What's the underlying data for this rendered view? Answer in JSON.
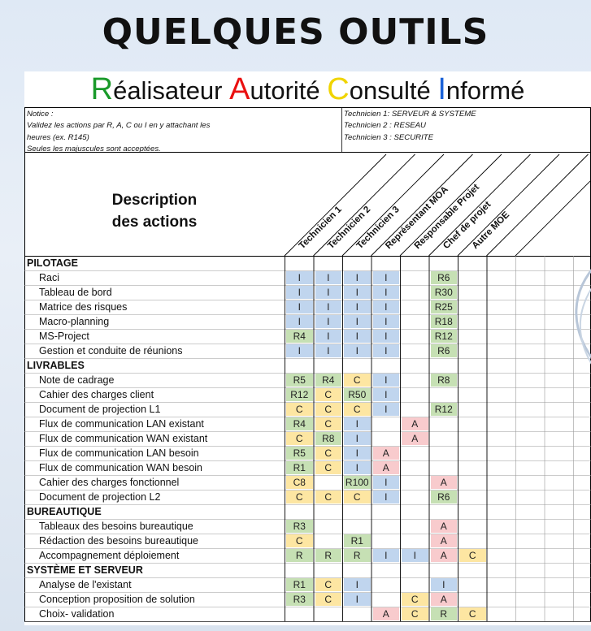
{
  "title": "QUELQUES OUTILS",
  "raci_title": [
    {
      "initial": "R",
      "rest": "éalisateur",
      "color": "r"
    },
    {
      "initial": "A",
      "rest": "utorité",
      "color": "a"
    },
    {
      "initial": "C",
      "rest": "onsulté",
      "color": "c"
    },
    {
      "initial": "I",
      "rest": "nformé",
      "color": "i"
    }
  ],
  "notice": [
    "Notice :",
    "Validez les actions par R, A, C ou I en y attachant les",
    "heures (ex. R145)",
    "Seules les majuscules sont acceptées."
  ],
  "technicians": [
    "Technicien 1:  SERVEUR & SYSTEME",
    "Technicien 2 :  RESEAU",
    "Technicien 3 : SECURITE"
  ],
  "description_header": [
    "Description",
    "des actions"
  ],
  "columns": [
    "Technicien 1",
    "Technicien 2",
    "Technicien 3",
    "Représentant MOA",
    "Responsable Projet",
    "Chef de projet",
    "Autre MOE"
  ],
  "colors": {
    "R": "#c6e0b4",
    "A": "#f8cbcd",
    "C": "#fde6a2",
    "I": "#c0d5ee"
  },
  "rows": [
    {
      "type": "section",
      "label": "PILOTAGE"
    },
    {
      "type": "item",
      "label": "Raci",
      "cells": [
        "I",
        "I",
        "I",
        "I",
        "",
        "R6",
        "",
        ""
      ]
    },
    {
      "type": "item",
      "label": "Tableau de bord",
      "cells": [
        "I",
        "I",
        "I",
        "I",
        "",
        "R30",
        "",
        ""
      ]
    },
    {
      "type": "item",
      "label": "Matrice des risques",
      "cells": [
        "I",
        "I",
        "I",
        "I",
        "",
        "R25",
        "",
        ""
      ]
    },
    {
      "type": "item",
      "label": "Macro-planning",
      "cells": [
        "I",
        "I",
        "I",
        "I",
        "",
        "R18",
        "",
        ""
      ]
    },
    {
      "type": "item",
      "label": "MS-Project",
      "cells": [
        "R4",
        "I",
        "I",
        "I",
        "",
        "R12",
        "",
        ""
      ]
    },
    {
      "type": "item",
      "label": "Gestion et conduite de réunions",
      "cells": [
        "I",
        "I",
        "I",
        "I",
        "",
        "R6",
        "",
        ""
      ]
    },
    {
      "type": "section",
      "label": "LIVRABLES"
    },
    {
      "type": "item",
      "label": "Note de cadrage",
      "cells": [
        "R5",
        "R4",
        "C",
        "I",
        "",
        "R8",
        "",
        ""
      ]
    },
    {
      "type": "item",
      "label": "Cahier des charges client",
      "cells": [
        "R12",
        "C",
        "R50",
        "I",
        "",
        "",
        "",
        ""
      ]
    },
    {
      "type": "item",
      "label": "Document de projection L1",
      "cells": [
        "C",
        "C",
        "C",
        "I",
        "",
        "R12",
        "",
        ""
      ]
    },
    {
      "type": "item",
      "label": "Flux de communication LAN existant",
      "cells": [
        "R4",
        "C",
        "I",
        "",
        "A",
        "",
        "",
        ""
      ]
    },
    {
      "type": "item",
      "label": "Flux de communication WAN existant",
      "cells": [
        "C",
        "R8",
        "I",
        "",
        "A",
        "",
        "",
        ""
      ]
    },
    {
      "type": "item",
      "label": "Flux de communication LAN besoin",
      "cells": [
        "R5",
        "C",
        "I",
        "A",
        "",
        "",
        "",
        ""
      ]
    },
    {
      "type": "item",
      "label": "Flux de communication WAN besoin",
      "cells": [
        "R1",
        "C",
        "I",
        "A",
        "",
        "",
        "",
        ""
      ]
    },
    {
      "type": "item",
      "label": "Cahier des charges fonctionnel",
      "cells": [
        "C8",
        "",
        "R100",
        "I",
        "",
        "A",
        "",
        ""
      ]
    },
    {
      "type": "item",
      "label": "Document de projection L2",
      "cells": [
        "C",
        "C",
        "C",
        "I",
        "",
        "R6",
        "",
        ""
      ]
    },
    {
      "type": "section",
      "label": "BUREAUTIQUE"
    },
    {
      "type": "item",
      "label": "Tableaux des besoins bureautique",
      "cells": [
        "R3",
        "",
        "",
        "",
        "",
        "A",
        "",
        ""
      ]
    },
    {
      "type": "item",
      "label": "Rédaction des besoins bureautique",
      "cells": [
        "C",
        "",
        "R1",
        "",
        "",
        "A",
        "",
        ""
      ]
    },
    {
      "type": "item",
      "label": "Accompagnement déploiement",
      "cells": [
        "R",
        "R",
        "R",
        "I",
        "I",
        "A",
        "C",
        ""
      ]
    },
    {
      "type": "section",
      "label": "SYSTÈME ET SERVEUR"
    },
    {
      "type": "item",
      "label": "Analyse de l'existant",
      "cells": [
        "R1",
        "C",
        "I",
        "",
        "",
        "I",
        "",
        ""
      ]
    },
    {
      "type": "item",
      "label": "Conception proposition de solution",
      "cells": [
        "R3",
        "C",
        "I",
        "",
        "C",
        "A",
        "",
        ""
      ]
    },
    {
      "type": "item",
      "label": "Choix- validation",
      "cells": [
        "",
        "",
        "",
        "A",
        "C",
        "R",
        "C",
        ""
      ]
    }
  ]
}
